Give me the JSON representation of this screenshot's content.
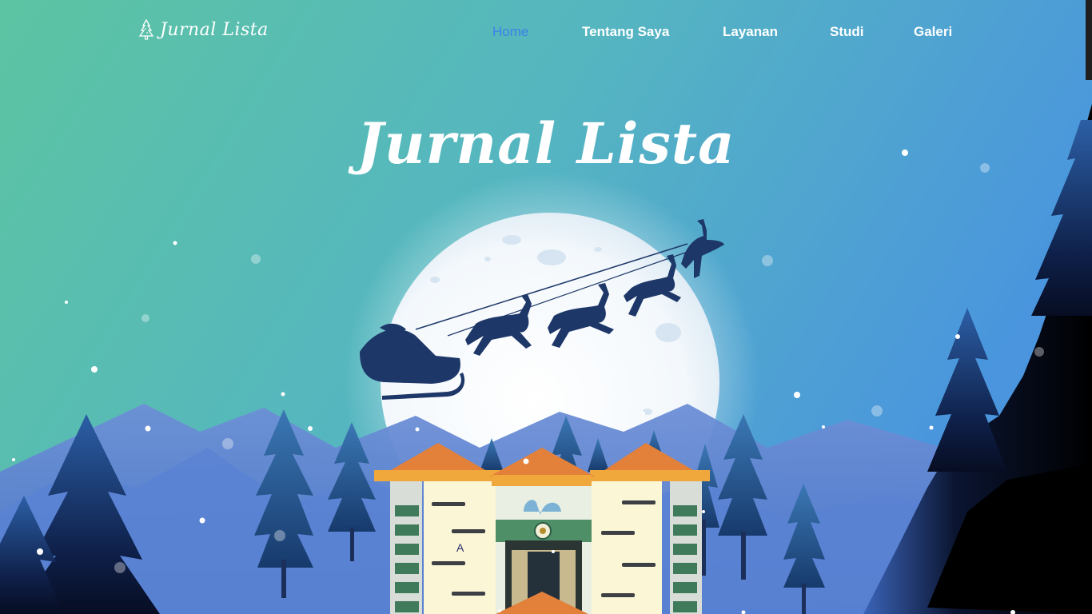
{
  "brand": {
    "name": "Jurnal Lista",
    "icon": "tree-icon"
  },
  "nav": {
    "items": [
      {
        "label": "Home",
        "active": true
      },
      {
        "label": "Tentang Saya",
        "active": false
      },
      {
        "label": "Layanan",
        "active": false
      },
      {
        "label": "Studi",
        "active": false
      },
      {
        "label": "Galeri",
        "active": false
      }
    ]
  },
  "hero": {
    "title": "Jurnal Lista",
    "building_letter": "A"
  },
  "colors": {
    "sky_top_left": "#5cc4a2",
    "sky_top_right": "#4b97dd",
    "active_link": "#3b82e6",
    "moon": "#eef6fb",
    "silhouette": "#1d3768",
    "roof": "#e3803a"
  }
}
